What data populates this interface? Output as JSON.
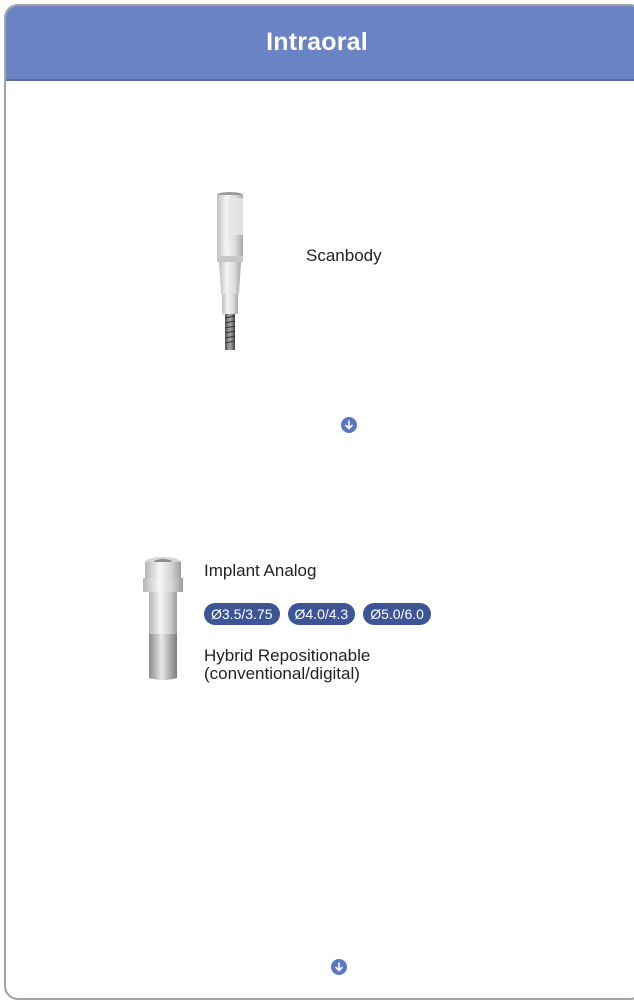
{
  "header": {
    "title": "Intraoral"
  },
  "scanbody": {
    "label": "Scanbody",
    "image_icon": "scanbody-image"
  },
  "arrows": [
    {
      "icon": "arrow-down-icon"
    },
    {
      "icon": "arrow-down-icon"
    }
  ],
  "analog": {
    "title": "Implant Analog",
    "sizes": [
      "Ø3.5/3.75",
      "Ø4.0/4.3",
      "Ø5.0/6.0"
    ],
    "description_line1": "Hybrid Repositionable",
    "description_line2": "(conventional/digital)",
    "image_icon": "implant-analog-image"
  },
  "colors": {
    "header": "#6983c4",
    "pill": "#3d5596",
    "arrow": "#5876c2"
  }
}
